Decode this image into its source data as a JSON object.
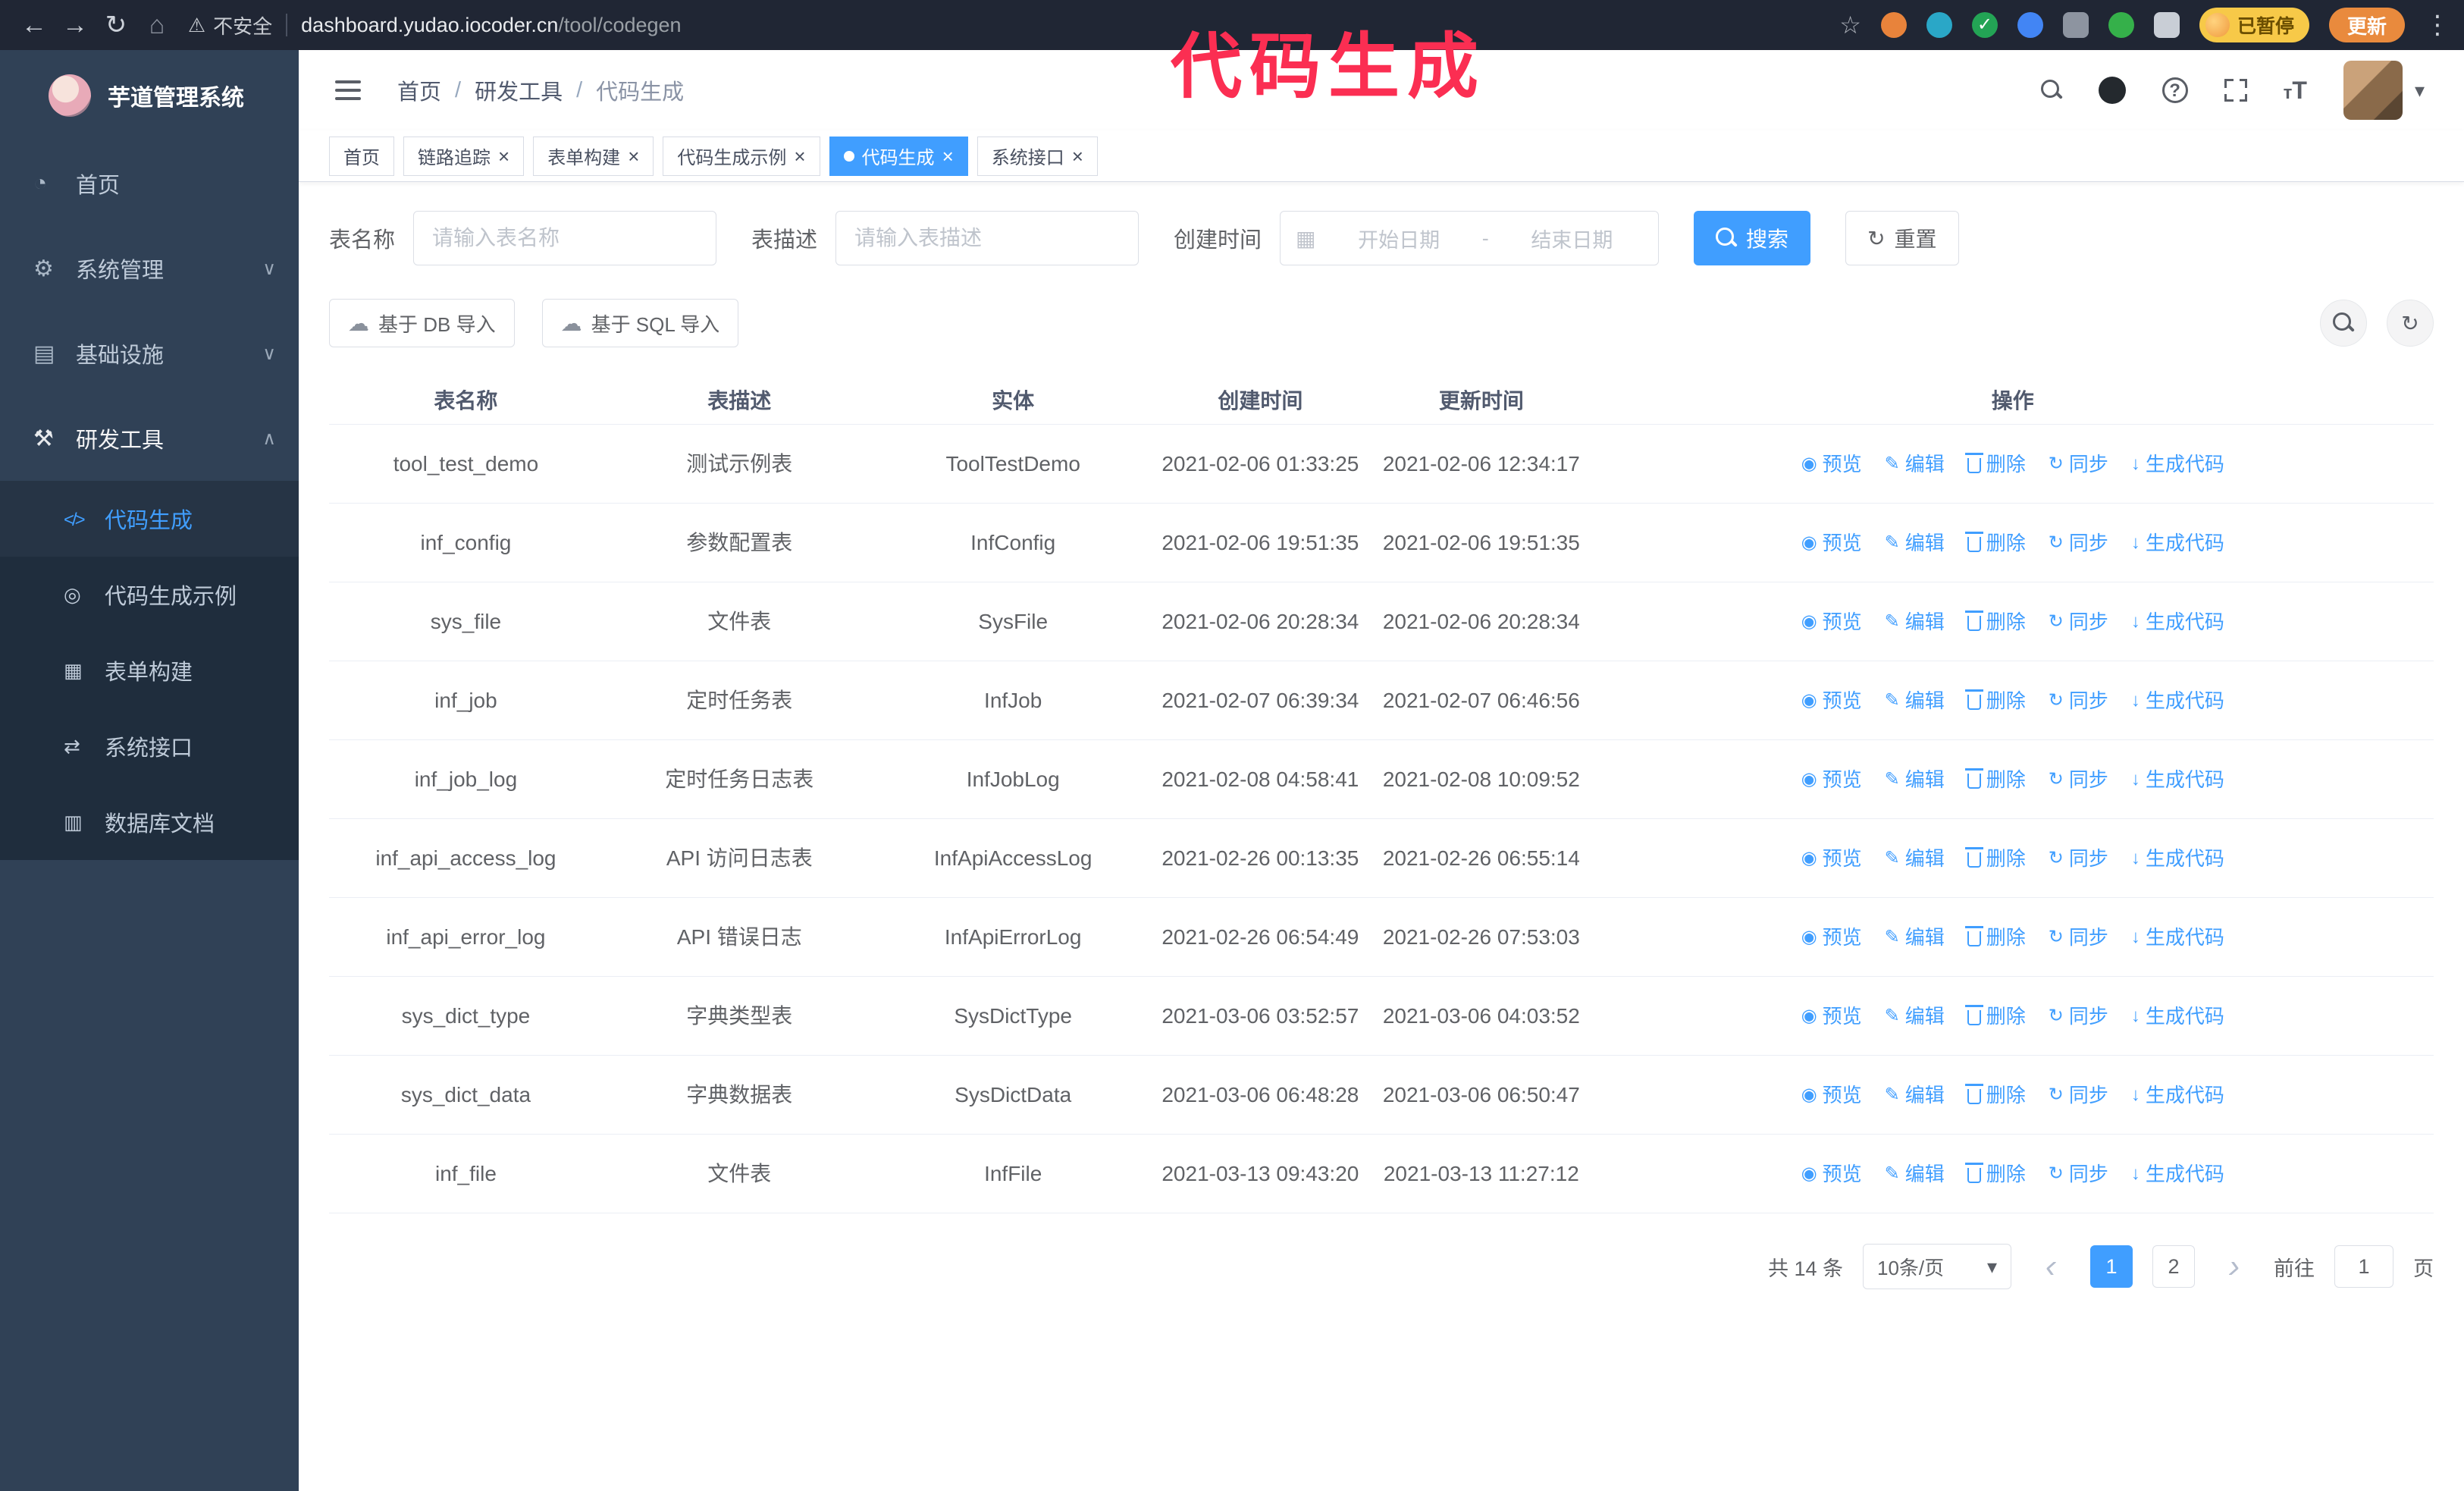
{
  "browser": {
    "security_label": "不安全",
    "url_domain": "dashboard.yudao.iocoder.cn",
    "url_path": "/tool/codegen",
    "paused_badge": "已暂停",
    "update_button": "更新"
  },
  "annotation": "代码生成",
  "colors": {
    "primary": "#409EFF",
    "annotation": "#fb2e52",
    "sidebar_bg": "#304156",
    "submenu_bg": "#1f2d3d"
  },
  "sidebar": {
    "logo_title": "芋道管理系统",
    "items": [
      {
        "label": "首页",
        "icon": "dashboard-icon",
        "chevron": "",
        "expanded": false
      },
      {
        "label": "系统管理",
        "icon": "gear-icon",
        "chevron": "down",
        "expanded": false
      },
      {
        "label": "基础设施",
        "icon": "infra-icon",
        "chevron": "down",
        "expanded": false
      },
      {
        "label": "研发工具",
        "icon": "tools-icon",
        "chevron": "up",
        "expanded": true
      }
    ],
    "subitems": [
      {
        "label": "代码生成",
        "icon": "code-icon",
        "active": true
      },
      {
        "label": "代码生成示例",
        "icon": "example-icon",
        "active": false
      },
      {
        "label": "表单构建",
        "icon": "form-icon",
        "active": false
      },
      {
        "label": "系统接口",
        "icon": "api-icon",
        "active": false
      },
      {
        "label": "数据库文档",
        "icon": "database-icon",
        "active": false
      }
    ]
  },
  "header": {
    "breadcrumb": [
      {
        "label": "首页"
      },
      {
        "label": "研发工具"
      },
      {
        "label": "代码生成"
      }
    ]
  },
  "tabs": [
    {
      "label": "首页",
      "closable": false,
      "active": false
    },
    {
      "label": "链路追踪",
      "closable": true,
      "active": false
    },
    {
      "label": "表单构建",
      "closable": true,
      "active": false
    },
    {
      "label": "代码生成示例",
      "closable": true,
      "active": false
    },
    {
      "label": "代码生成",
      "closable": true,
      "active": true
    },
    {
      "label": "系统接口",
      "closable": true,
      "active": false
    }
  ],
  "filters": {
    "table_name_label": "表名称",
    "table_name_placeholder": "请输入表名称",
    "table_desc_label": "表描述",
    "table_desc_placeholder": "请输入表描述",
    "create_time_label": "创建时间",
    "date_start_placeholder": "开始日期",
    "date_separator": "-",
    "date_end_placeholder": "结束日期",
    "search_button": "搜索",
    "reset_button": "重置"
  },
  "toolbar": {
    "import_db_button": "基于 DB 导入",
    "import_sql_button": "基于 SQL 导入"
  },
  "table": {
    "columns": [
      "表名称",
      "表描述",
      "实体",
      "创建时间",
      "更新时间",
      "操作"
    ],
    "actions": [
      "预览",
      "编辑",
      "删除",
      "同步",
      "生成代码"
    ],
    "rows": [
      {
        "name": "tool_test_demo",
        "desc": "测试示例表",
        "entity": "ToolTestDemo",
        "created": "2021-02-06 01:33:25",
        "updated": "2021-02-06 12:34:17"
      },
      {
        "name": "inf_config",
        "desc": "参数配置表",
        "entity": "InfConfig",
        "created": "2021-02-06 19:51:35",
        "updated": "2021-02-06 19:51:35"
      },
      {
        "name": "sys_file",
        "desc": "文件表",
        "entity": "SysFile",
        "created": "2021-02-06 20:28:34",
        "updated": "2021-02-06 20:28:34"
      },
      {
        "name": "inf_job",
        "desc": "定时任务表",
        "entity": "InfJob",
        "created": "2021-02-07 06:39:34",
        "updated": "2021-02-07 06:46:56"
      },
      {
        "name": "inf_job_log",
        "desc": "定时任务日志表",
        "entity": "InfJobLog",
        "created": "2021-02-08 04:58:41",
        "updated": "2021-02-08 10:09:52"
      },
      {
        "name": "inf_api_access_log",
        "desc": "API 访问日志表",
        "entity": "InfApiAccessLog",
        "created": "2021-02-26 00:13:35",
        "updated": "2021-02-26 06:55:14"
      },
      {
        "name": "inf_api_error_log",
        "desc": "API 错误日志",
        "entity": "InfApiErrorLog",
        "created": "2021-02-26 06:54:49",
        "updated": "2021-02-26 07:53:03"
      },
      {
        "name": "sys_dict_type",
        "desc": "字典类型表",
        "entity": "SysDictType",
        "created": "2021-03-06 03:52:57",
        "updated": "2021-03-06 04:03:52"
      },
      {
        "name": "sys_dict_data",
        "desc": "字典数据表",
        "entity": "SysDictData",
        "created": "2021-03-06 06:48:28",
        "updated": "2021-03-06 06:50:47"
      },
      {
        "name": "inf_file",
        "desc": "文件表",
        "entity": "InfFile",
        "created": "2021-03-13 09:43:20",
        "updated": "2021-03-13 11:27:12"
      }
    ]
  },
  "pagination": {
    "total_label": "共 14 条",
    "page_size": "10条/页",
    "pages": [
      {
        "label": "1",
        "active": true
      },
      {
        "label": "2",
        "active": false
      }
    ],
    "goto_label": "前往",
    "goto_value": "1",
    "goto_suffix": "页"
  }
}
